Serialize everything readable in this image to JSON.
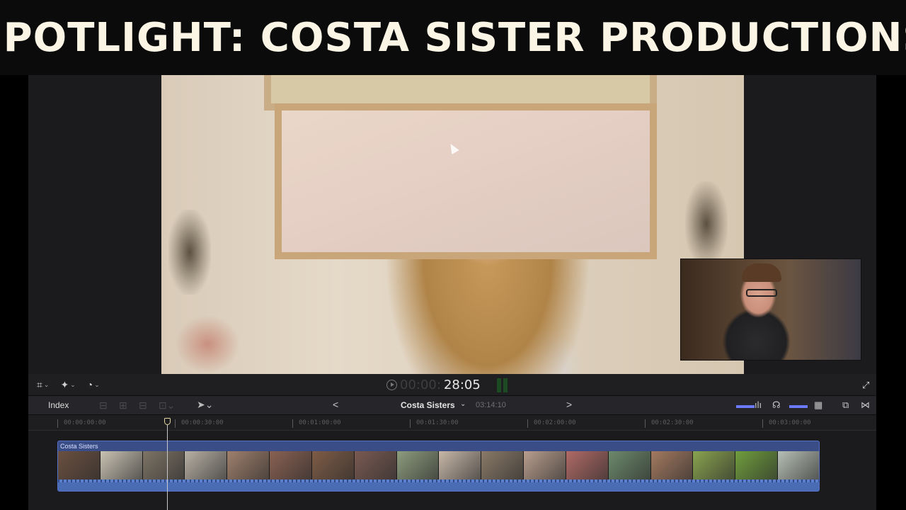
{
  "banner": {
    "title": "SPOTLIGHT: COSTA SISTER PRODUCTIONS"
  },
  "viewer": {
    "timecode_dim": "00:00:",
    "timecode": "28:05"
  },
  "toolbar": {
    "index_label": "Index",
    "project_name": "Costa Sisters",
    "project_duration": "03:14:10"
  },
  "ruler": {
    "ticks": [
      "00:00:00:00",
      "00:00:30:00",
      "00:01:00:00",
      "00:01:30:00",
      "00:02:00:00",
      "00:02:30:00",
      "00:03:00:00"
    ]
  },
  "timeline": {
    "clip_name": "Costa Sisters",
    "frame_colors": [
      "#6b5040",
      "#c9c2b3",
      "#7e7466",
      "#b8b0a4",
      "#a0806c",
      "#8a6152",
      "#7f5c46",
      "#7a5a52",
      "#8d9c7e",
      "#c7b7a8",
      "#8a7a68",
      "#b99e8e",
      "#b06a66",
      "#6d8a6c",
      "#a47a60",
      "#89a34f",
      "#6f9e3d",
      "#b6bfb5"
    ]
  },
  "icons": {
    "crop": "crop-icon",
    "magic": "magic-wand-icon",
    "speed": "speed-icon",
    "select": "select-arrow-icon",
    "expand": "fullscreen-icon"
  }
}
